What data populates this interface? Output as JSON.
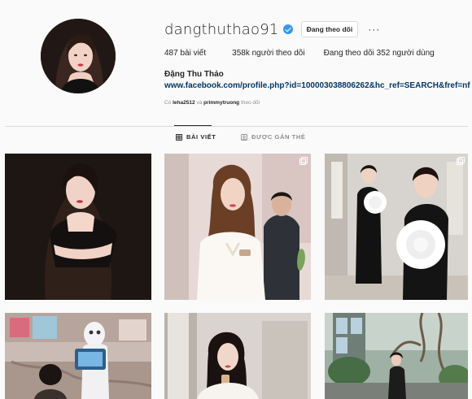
{
  "profile": {
    "username": "dangthuthao91",
    "verified": true,
    "follow_button": "Đang theo dõi",
    "more_label": "···",
    "stats": {
      "posts": "487 bài viết",
      "followers": "358k người theo dõi",
      "following": "Đang theo dõi 352 người dùng"
    },
    "full_name": "Đặng Thu Thảo",
    "link": "www.facebook.com/profile.php?id=100003038806262&hc_ref=SEARCH&fref=nf",
    "followed_by": {
      "prefix": "Có",
      "user1": "leha2512",
      "joiner": "và",
      "user2": "primmytruong",
      "suffix": "theo dõi"
    }
  },
  "tabs": [
    {
      "label": "BÀI VIẾT",
      "icon": "grid-icon",
      "active": true
    },
    {
      "label": "ĐƯỢC GẮN THẺ",
      "icon": "tag-icon",
      "active": false
    }
  ],
  "posts": [
    {
      "id": "post-1",
      "multi": false
    },
    {
      "id": "post-2",
      "multi": true
    },
    {
      "id": "post-3",
      "multi": true
    },
    {
      "id": "post-4",
      "multi": false
    },
    {
      "id": "post-5",
      "multi": false
    },
    {
      "id": "post-6",
      "multi": false
    }
  ],
  "colors": {
    "background": "#fafafa",
    "verified": "#3897f0",
    "link": "#00376b",
    "muted": "#8e8e8e",
    "divider": "#dbdbdb"
  }
}
